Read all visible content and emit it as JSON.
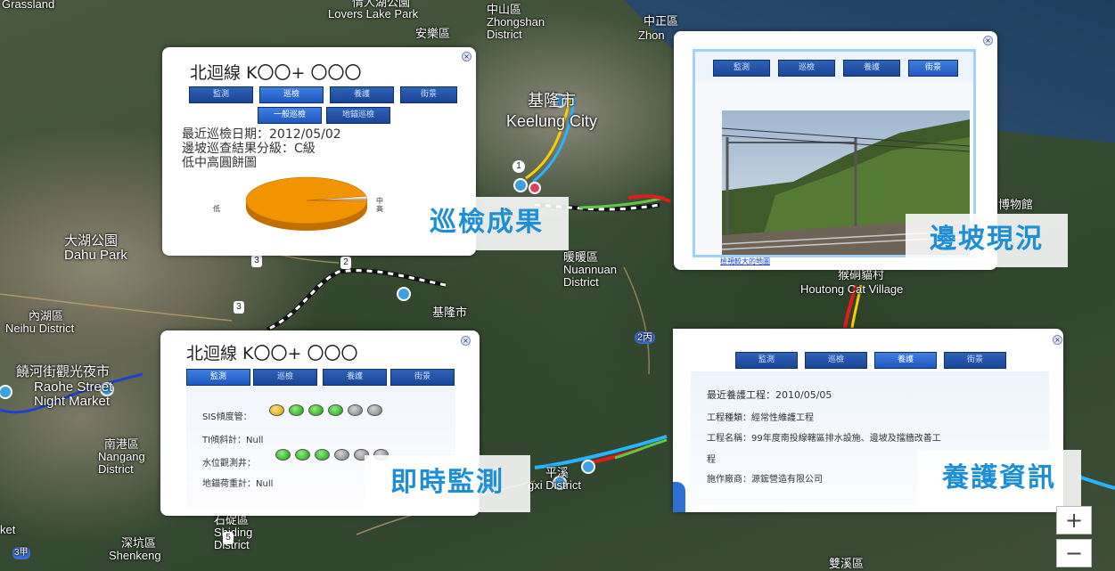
{
  "map": {
    "labels": {
      "grassland": "Grassland",
      "lovers_lake_zh": "情人湖公園",
      "lovers_lake_en": "Lovers Lake Park",
      "anle": "安樂區",
      "zhongshan_zh": "中山區",
      "zhongshan_en1": "Zhongshan",
      "zhongshan_en2": "District",
      "zhongzheng_zh": "中正區",
      "zhongzheng_en": "Zhon",
      "keelung_zh": "基隆市",
      "keelung_en": "Keelung City",
      "dahu_zh": "大湖公園",
      "dahu_en": "Dahu Park",
      "neihu_zh": "內湖區",
      "neihu_en": "Neihu District",
      "raohe_zh": "饒河街觀光夜市",
      "raohe_en1": "Raohe Street",
      "raohe_en2": "Night Market",
      "nangang_zh": "南港區",
      "nangang_en1": "Nangang",
      "nangang_en2": "District",
      "nuannuan_zh": "暖暖區",
      "nuannuan_en1": "Nuannuan",
      "nuannuan_en2": "District",
      "keelung2": "基隆市",
      "route2": "2丙",
      "houtong_zh": "猴硐貓村",
      "houtong_en": "Houtong Cat Village",
      "museum": "博物館",
      "pingxi": "平溪",
      "pingxi_en": "gxi District",
      "shiding_zh": "石碇區",
      "shiding_en1": "Shiding",
      "shiding_en2": "District",
      "shenkeng_zh": "深坑區",
      "shenkeng_en": "Shenkeng",
      "ket": "ket",
      "shuangxi": "雙溪區",
      "r1": "1",
      "r3": "3",
      "r3b": "3",
      "r2": "2",
      "r5": "5",
      "r3edge": "3甲"
    },
    "zoom_in": "+",
    "zoom_out": "−"
  },
  "popup_patrol": {
    "title": "北迴線 K〇〇+ 〇〇〇",
    "tabs": [
      "監測",
      "巡檢",
      "養護",
      "街景"
    ],
    "subtabs": [
      "一般巡檢",
      "地錨巡檢"
    ],
    "lines": [
      "最近巡檢日期：2012/05/02",
      "邊坡巡查結果分級：C級",
      "低中高圓餅圖"
    ],
    "pie_left_label": "低",
    "pie_right_label": "中高",
    "caption": "巡檢成果"
  },
  "chart_data": {
    "type": "pie",
    "title": "低中高圓餅圖",
    "categories": [
      "低",
      "中",
      "高"
    ],
    "values": [
      97,
      2,
      1
    ],
    "colors": [
      "#f29400",
      "#e8e8e8",
      "#d0d0d0"
    ]
  },
  "popup_slope": {
    "tabs": [
      "監測",
      "巡檢",
      "養護",
      "街景"
    ],
    "link": "檢視較大的地圖",
    "caption": "邊坡現況"
  },
  "popup_monitor": {
    "title": "北迴線 K〇〇+ 〇〇〇",
    "tabs": [
      "監測",
      "巡檢",
      "養護",
      "街景"
    ],
    "rows": [
      {
        "label": "SIS傾度管：",
        "dots": [
          "yellow",
          "green",
          "green",
          "green",
          "gray",
          "gray"
        ]
      },
      {
        "label": "TI傾斜計：Null",
        "dots": []
      },
      {
        "label": "水位觀測井：",
        "dots": [
          "green",
          "green",
          "green",
          "gray",
          "gray",
          "gray"
        ]
      },
      {
        "label": "地錨荷重計：Null",
        "dots": []
      }
    ],
    "caption": "即時監測"
  },
  "popup_maint": {
    "tabs": [
      "監測",
      "巡檢",
      "養護",
      "街景"
    ],
    "lines": [
      "最近養護工程：2010/05/05",
      "工程種類：經常性維護工程",
      "工程名稱：99年度南投線轄區排水設施、邊坡及擋牆改善工",
      "程",
      "施作廠商：源鋐營造有限公司"
    ],
    "caption": "養護資訊"
  }
}
